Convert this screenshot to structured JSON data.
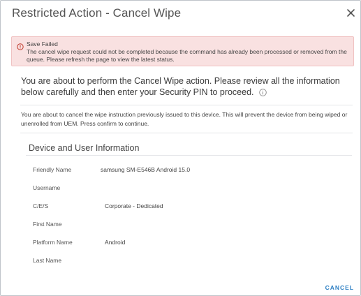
{
  "dialog": {
    "title": "Restricted Action - Cancel Wipe",
    "close_icon": "close-icon"
  },
  "alert": {
    "icon": "error-icon",
    "heading": "Save Failed",
    "message": "The cancel wipe request could not be completed because the command has already been processed or removed from the queue. Please refresh the page to view the latest status.",
    "color": "#c0392b"
  },
  "intro": {
    "text": "You are about to perform the Cancel Wipe action. Please review all the information below carefully and then enter your Security PIN to proceed.",
    "info_icon": "info-icon"
  },
  "description": "You are about to cancel the wipe instruction previously issued to this device. This will prevent the device from being wiped or unenrolled from UEM. Press confirm to continue.",
  "details": {
    "section_title": "Device and User Information",
    "fields": [
      {
        "label": "Friendly Name",
        "value": "samsung SM-E546B Android 15.0"
      },
      {
        "label": "Username",
        "value": ""
      },
      {
        "label": "C/E/S",
        "value": "Corporate - Dedicated"
      },
      {
        "label": "First Name",
        "value": ""
      },
      {
        "label": "Platform Name",
        "value": "Android"
      },
      {
        "label": "Last Name",
        "value": ""
      }
    ]
  },
  "footer": {
    "cancel_label": "CANCEL",
    "accent": "#2d7fc3"
  }
}
